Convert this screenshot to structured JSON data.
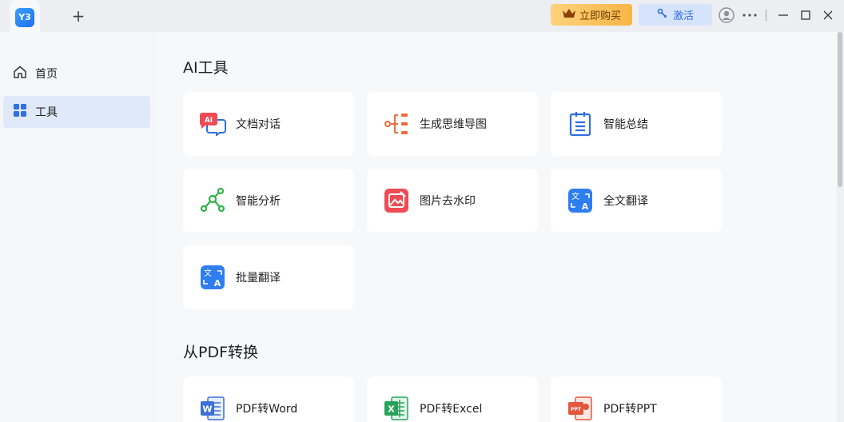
{
  "titlebar": {
    "logo_text": "Y3",
    "buy_label": "立即购买",
    "activate_label": "激活"
  },
  "sidebar": {
    "items": [
      {
        "label": "首页",
        "icon": "home-icon"
      },
      {
        "label": "工具",
        "icon": "grid-icon",
        "active": true
      }
    ]
  },
  "sections": {
    "ai": {
      "title": "AI工具",
      "cards": [
        {
          "label": "文档对话",
          "icon": "ai-chat-icon",
          "icon_text": "AI"
        },
        {
          "label": "生成思维导图",
          "icon": "mindmap-icon"
        },
        {
          "label": "智能总结",
          "icon": "summary-icon"
        },
        {
          "label": "智能分析",
          "icon": "analysis-icon"
        },
        {
          "label": "图片去水印",
          "icon": "watermark-remove-icon"
        },
        {
          "label": "全文翻译",
          "icon": "translate-icon",
          "icon_text_a": "文",
          "icon_text_b": "A"
        },
        {
          "label": "批量翻译",
          "icon": "batch-translate-icon",
          "icon_text_a": "文",
          "icon_text_b": "A"
        }
      ]
    },
    "pdf": {
      "title": "从PDF转换",
      "cards": [
        {
          "label": "PDF转Word",
          "icon": "word-icon",
          "icon_text": "W"
        },
        {
          "label": "PDF转Excel",
          "icon": "excel-icon",
          "icon_text": "X"
        },
        {
          "label": "PDF转PPT",
          "icon": "ppt-icon",
          "icon_text": "PPT"
        }
      ]
    }
  },
  "colors": {
    "accent": "#2f6fe0",
    "buy_bg": "#f7b547",
    "activate_bg": "#d6e4fb",
    "ai_red": "#ef4b55",
    "mindmap_orange": "#f06a3c",
    "analysis_green": "#2fb24a",
    "word_blue": "#3b6fd9",
    "excel_green": "#29a35a",
    "ppt_red": "#e4573d"
  }
}
